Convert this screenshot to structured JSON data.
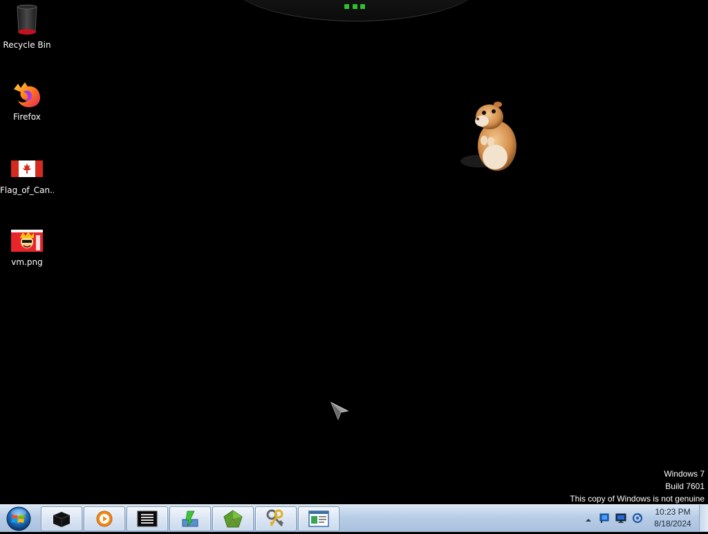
{
  "desktop": {
    "icons": [
      {
        "label": "Recycle Bin",
        "icon": "recycle-bin-icon"
      },
      {
        "label": "Firefox",
        "icon": "firefox-icon"
      },
      {
        "label": "Flag_of_Can...",
        "icon": "canada-flag-icon"
      },
      {
        "label": "vm.png",
        "icon": "image-file-icon"
      }
    ],
    "watermark": {
      "line1": "Windows 7",
      "line2": "Build 7601",
      "line3": "This copy of Windows is not genuine"
    },
    "hamster_gadget": "hamster-gadget-icon"
  },
  "taskbar": {
    "start": "start-orb-icon",
    "pinned": [
      {
        "icon": "black-box-app-icon"
      },
      {
        "icon": "media-player-icon"
      },
      {
        "icon": "terminal-list-icon"
      },
      {
        "icon": "installer-icon"
      },
      {
        "icon": "green-pentagon-app-icon"
      },
      {
        "icon": "keys-icon"
      },
      {
        "icon": "document-window-icon"
      }
    ],
    "tray": {
      "icons": [
        "show-hidden-icons-arrow",
        "network-flag-icon",
        "monitor-icon",
        "sync-icon"
      ],
      "time": "10:23 PM",
      "date": "8/18/2024"
    }
  },
  "colors": {
    "desktop_bg": "#000000",
    "taskbar_top": "#d9e6f4",
    "taskbar_bottom": "#a9c0de"
  }
}
